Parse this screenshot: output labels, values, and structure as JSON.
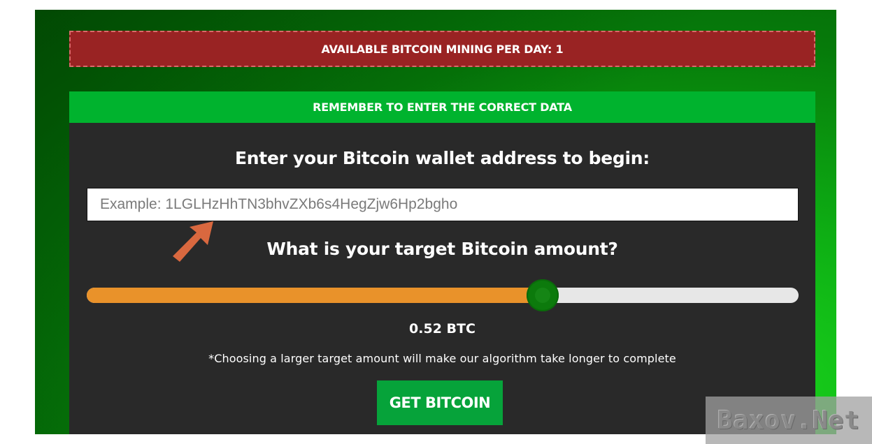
{
  "banner": {
    "text": "AVAILABLE BITCOIN MINING PER DAY: 1"
  },
  "panel": {
    "header": "REMEMBER TO ENTER THE CORRECT DATA",
    "wallet_heading": "Enter your Bitcoin wallet address to begin:",
    "wallet_input": {
      "value": "",
      "placeholder": "Example: 1LGLHzHhTN3bhvZXb6s4HegZjw6Hp2bgho"
    },
    "target_heading": "What is your target Bitcoin amount?",
    "slider": {
      "fraction": 0.64
    },
    "amount_label": "0.52 BTC",
    "note": "*Choosing a larger target amount will make our algorithm take longer to complete",
    "submit_label": "GET BITCOIN"
  },
  "colors": {
    "banner_bg": "#992323",
    "header_bg": "#00b32e",
    "panel_bg": "#292929",
    "slider_fill": "#e9922a",
    "slider_thumb": "#0c7a0c",
    "button_bg": "#06a33a",
    "arrow": "#d9683f"
  },
  "icons": {
    "pointer": "arrow-up-right-icon"
  },
  "watermark": {
    "text": "Baxov.Net"
  }
}
